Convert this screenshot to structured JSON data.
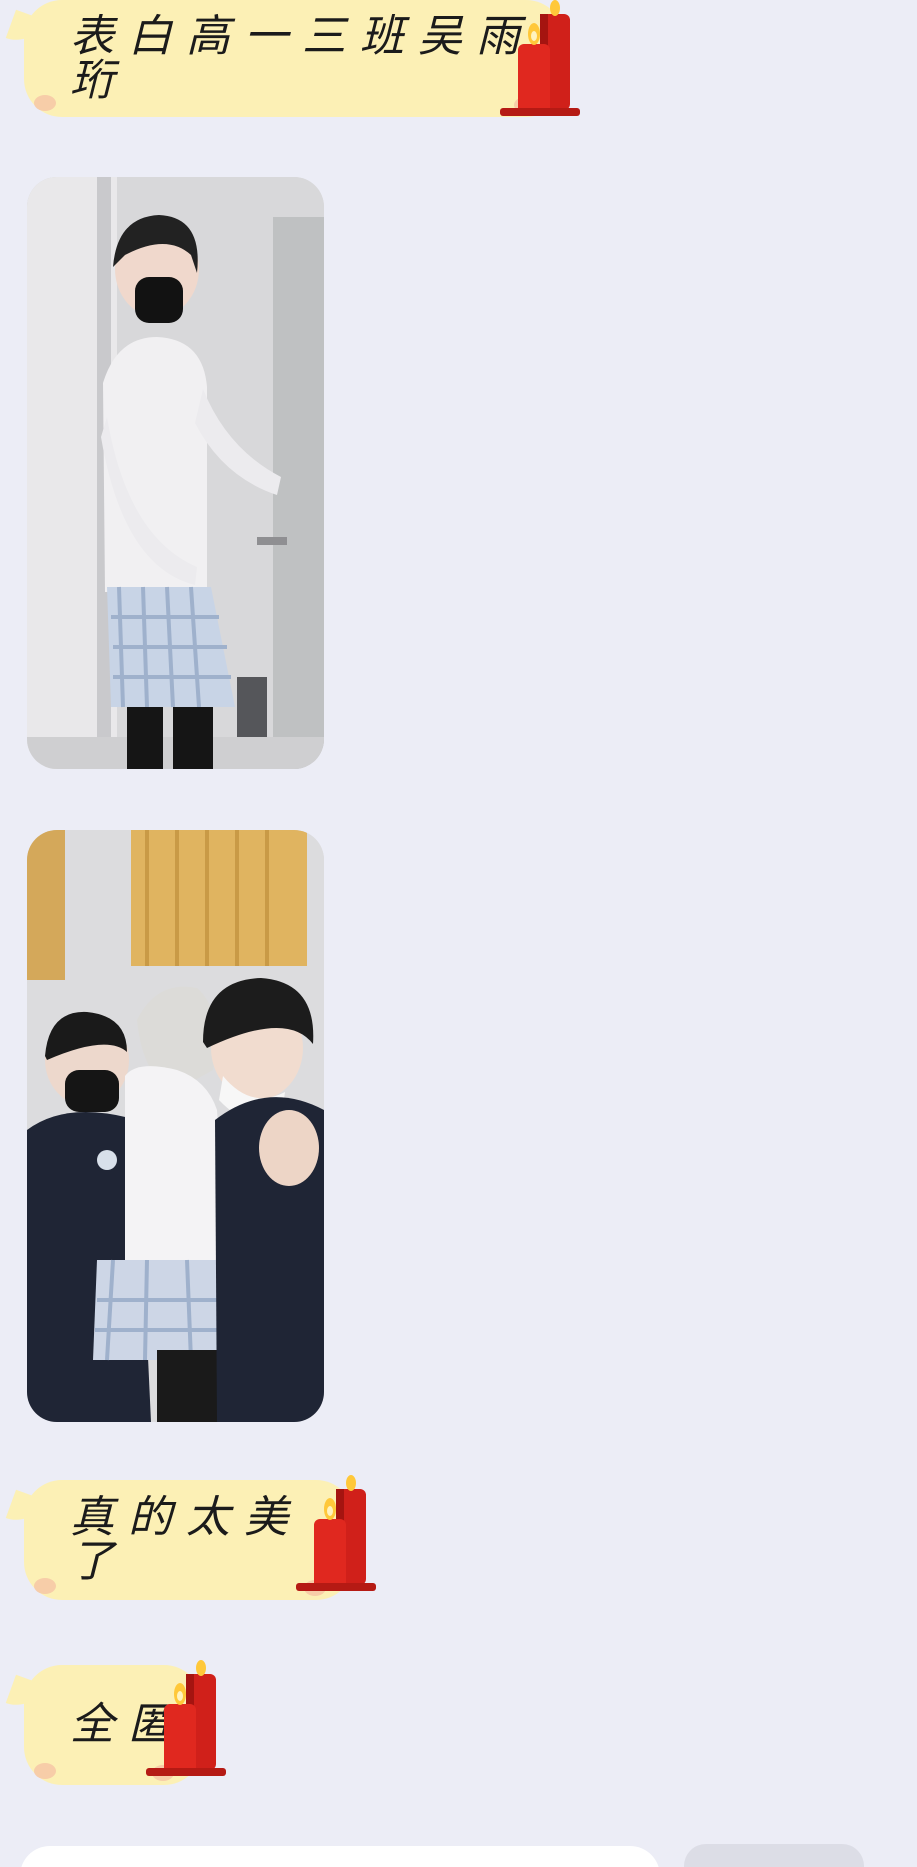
{
  "messages": [
    {
      "type": "text",
      "text": "表白高一三班吴雨珩",
      "decoration": "candle-emoji"
    },
    {
      "type": "image",
      "description_icon": "photo-person-in-doorway"
    },
    {
      "type": "image",
      "description_icon": "photo-group-of-three"
    },
    {
      "type": "text",
      "text": "真的太美了",
      "decoration": "candle-emoji"
    },
    {
      "type": "text",
      "text": "全匿",
      "decoration": "candle-emoji"
    }
  ],
  "colors": {
    "background": "#ecedf6",
    "bubble": "#fcf0b5",
    "bubble_accent": "#f6c7a6",
    "candle_red": "#d0201a",
    "flame": "#ffc83a"
  }
}
